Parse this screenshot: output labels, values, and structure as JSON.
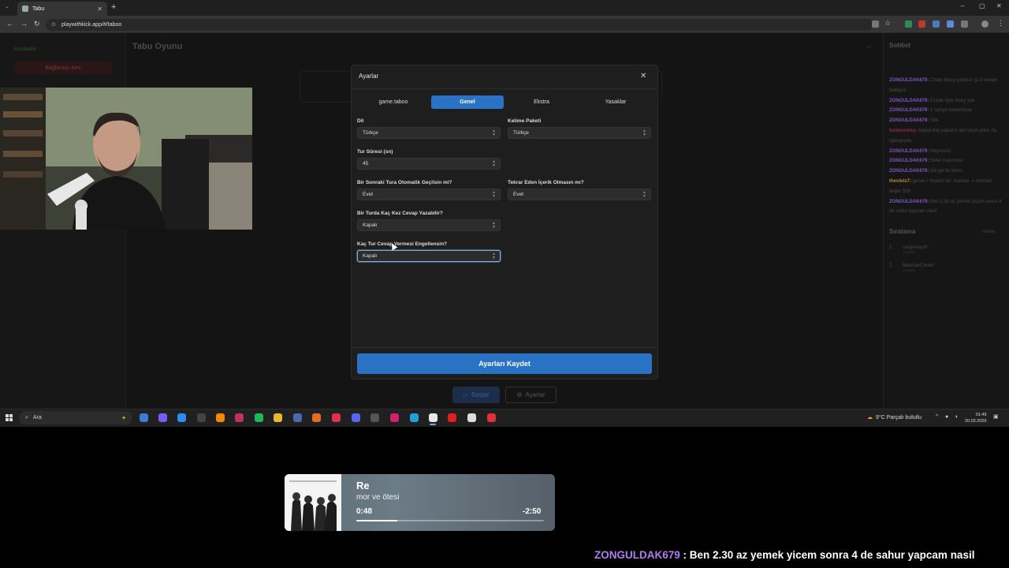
{
  "browser": {
    "tab_title": "Tabu",
    "url": "playwithkick.app/#/taboo"
  },
  "sidebar": {
    "brand": "KickSation",
    "disconnect_label": "Bağlantıyı Kes"
  },
  "page": {
    "title": "Tabu Oyunu",
    "start_label": "Başlat",
    "settings_label": "Ayarlar"
  },
  "modal": {
    "title": "Ayarlar",
    "tabs": [
      {
        "label": "game.taboo"
      },
      {
        "label": "Genel"
      },
      {
        "label": "Ekstra"
      },
      {
        "label": "Yasaklar"
      }
    ],
    "active_tab": "Genel",
    "fields": {
      "language": {
        "label": "Dil",
        "value": "Türkçe"
      },
      "word_pack": {
        "label": "Kelime Paketi",
        "value": "Türkçe"
      },
      "round_duration": {
        "label": "Tur Süresi (sn)",
        "value": "45"
      },
      "auto_next": {
        "label": "Bir Sonraki Tura Otomatik Geçilsin mi?",
        "value": "Evet"
      },
      "no_repeat": {
        "label": "Tekrar Eden İçerik Olmasın mı?",
        "value": "Evet"
      },
      "answers_per_round": {
        "label": "Bir Turda Kaç Kez Cevap Yazabilir?",
        "value": "Kapalı"
      },
      "block_rounds": {
        "label": "Kaç Tur Cevap Vermesi Engellensin?",
        "value": "Kapalı"
      }
    },
    "save_label": "Ayarları Kaydet"
  },
  "chat": {
    "title": "Sohbet",
    "messages": [
      {
        "user": "ZONGULDAK679:",
        "text": " Chate bisey yaziyoz ya 2 saniye bekliyoz",
        "color": "#7e57c2"
      },
      {
        "user": "ZONGULDAK679:",
        "text": " Ecede öyle bisey yok",
        "color": "#7e57c2"
      },
      {
        "user": "ZONGULDAK679:",
        "text": " 2 saniye beklemiyor",
        "color": "#7e57c2"
      },
      {
        "user": "ZONGULDAK679:",
        "text": " Sirk",
        "color": "#7e57c2"
      },
      {
        "user": "bobmonkey:",
        "text": " başka bişi yapalım şkli iyiydi şkilar da işleniyordu",
        "color": "#8a2a3a"
      },
      {
        "user": "ZONGULDAK679:",
        "text": " Maymunu",
        "color": "#7e57c2"
      },
      {
        "user": "ZONGULDAK679:",
        "text": " Sirke maymunu",
        "color": "#7e57c2"
      },
      {
        "user": "ZONGULDAK679:",
        "text": " Abi gel bi öpem",
        "color": "#7e57c2"
      },
      {
        "user": "thevlets7:",
        "text": " genel-> toplam tur: manuel -> manuel değer 500",
        "color": "#b08a2a"
      },
      {
        "user": "ZONGULDAK679:",
        "text": " Ben 2,30 az yemek yicem sonra 4 de sahur yapcam nasil",
        "color": "#7e57c2"
      }
    ]
  },
  "ranking": {
    "title": "Sıralama",
    "show_label": "Göster",
    "items": [
      {
        "rank": "1.",
        "name": "canyesilyurt",
        "points": "10 puan"
      },
      {
        "rank": "2.",
        "name": "BatuhanCimen",
        "points": "10 puan"
      }
    ]
  },
  "taskbar": {
    "search_placeholder": "Ara",
    "weather": "9°C  Parçalı bulutlu",
    "time": "01:49",
    "date": "20.02.2026"
  },
  "now_playing": {
    "title": "Re",
    "artist": "mor ve ötesi",
    "elapsed": "0:48",
    "remaining": "-2:50",
    "progress": 0.22
  },
  "overlay_chat": {
    "user": "ZONGULDAK679",
    "text": " : Ben 2.30 az yemek yicem sonra 4 de sahur yapcam nasil"
  }
}
